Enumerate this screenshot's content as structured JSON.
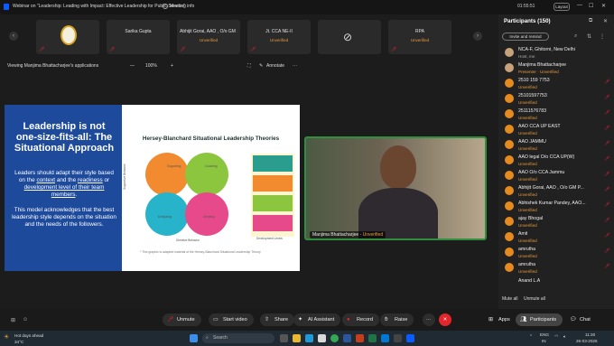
{
  "window": {
    "title": "Webinar on \"Leadership: Leading with Impact: Effective Leadership for Public Service\"",
    "meeting_info": "Meeting info",
    "timer": "01:55:51",
    "layout_label": "Layout"
  },
  "strip": {
    "tiles": [
      {
        "name": "",
        "status": ""
      },
      {
        "name": "Sarika Gupta",
        "status": "Unverified"
      },
      {
        "name": "Abhijit Gorai, AAO , O/o GM ...",
        "status": "Unverified"
      },
      {
        "name": "Jt. CCA NE-II",
        "status": "Unverified"
      },
      {
        "name": "",
        "status": ""
      },
      {
        "name": "RPA",
        "status": "Unverified"
      }
    ]
  },
  "viewbar": {
    "label": "Viewing Manjima Bhattacharjee's applications",
    "zoom": "100%",
    "annotate": "Annotate"
  },
  "slide": {
    "title": "Leadership is not one-size-fits-all: The Situational Approach",
    "p1_a": "Leaders should adapt their style based on the",
    "p1_context": "context",
    "p1_b": "and the",
    "p1_readiness": "readiness",
    "p1_c": "or",
    "p1_dev": "development level of their team members",
    "p1_end": ".",
    "p2": "This model acknowledges that the best leadership style depends on the situation and the needs of the followers.",
    "diagram_title": "Hersey-Blanchard Situational Leadership Theories",
    "q_labels": [
      "Supporting",
      "Coaching",
      "Delegating",
      "Directing"
    ],
    "x_axis": "Directive Behavior",
    "y_axis": "Supportive Behavior",
    "legend_caption": "Development Levels",
    "footnote": "* This graphic is adapted material of the Hersey-Blanchard Situational Leadership Theory"
  },
  "video": {
    "name": "Manjima Bhattacharjee",
    "status": "Unverified"
  },
  "participants": {
    "header": "Participants (150)",
    "invite": "Invite and remind",
    "list": [
      {
        "name": "NCA-F, Ghitorni, New Delhi",
        "sub": "Host, me",
        "sub_type": "host"
      },
      {
        "name": "Manjima Bhattacharjee",
        "sub": "Presenter · Unverified",
        "sub_type": "unv"
      },
      {
        "name": "2510 159 7753",
        "sub": "Unverified",
        "sub_type": "unv"
      },
      {
        "name": "25101597753",
        "sub": "Unverified",
        "sub_type": "unv"
      },
      {
        "name": "25111576783",
        "sub": "Unverified",
        "sub_type": "unv"
      },
      {
        "name": "AAO CCA UP EAST",
        "sub": "Unverified",
        "sub_type": "unv"
      },
      {
        "name": "AAO JAMMU",
        "sub": "Unverified",
        "sub_type": "unv"
      },
      {
        "name": "AAO legal O/o CCA UP(W)",
        "sub": "Unverified",
        "sub_type": "unv"
      },
      {
        "name": "AAO O/o CCA Jammu",
        "sub": "Unverified",
        "sub_type": "unv"
      },
      {
        "name": "Abhijit Gorai, AAO , O/o GM P...",
        "sub": "Unverified",
        "sub_type": "unv"
      },
      {
        "name": "Abhishek Kumar Pandey, AAO...",
        "sub": "Unverified",
        "sub_type": "unv"
      },
      {
        "name": "ajay Bhogal",
        "sub": "Unverified",
        "sub_type": "unv"
      },
      {
        "name": "Amit",
        "sub": "Unverified",
        "sub_type": "unv"
      },
      {
        "name": "amrutha",
        "sub": "Unverified",
        "sub_type": "unv"
      },
      {
        "name": "amrutha",
        "sub": "Unverified",
        "sub_type": "unv"
      },
      {
        "name": "Anand L.A",
        "sub": "",
        "sub_type": "unv"
      }
    ],
    "mute_all": "Mute all",
    "unmute_all": "Unmute all"
  },
  "toolbar": {
    "unmute": "Unmute",
    "start_video": "Start video",
    "share": "Share",
    "ai": "AI Assistant",
    "record": "Record",
    "raise": "Raise",
    "more": "···",
    "end": "✕",
    "apps": "Apps",
    "participants": "Participants",
    "chat": "Chat"
  },
  "taskbar": {
    "weather_title": "Hot days ahead",
    "weather_temp": "34°C",
    "search": "Search",
    "lang": "ENG",
    "lang2": "IN",
    "time": "11:30",
    "date": "26-03-2026"
  }
}
